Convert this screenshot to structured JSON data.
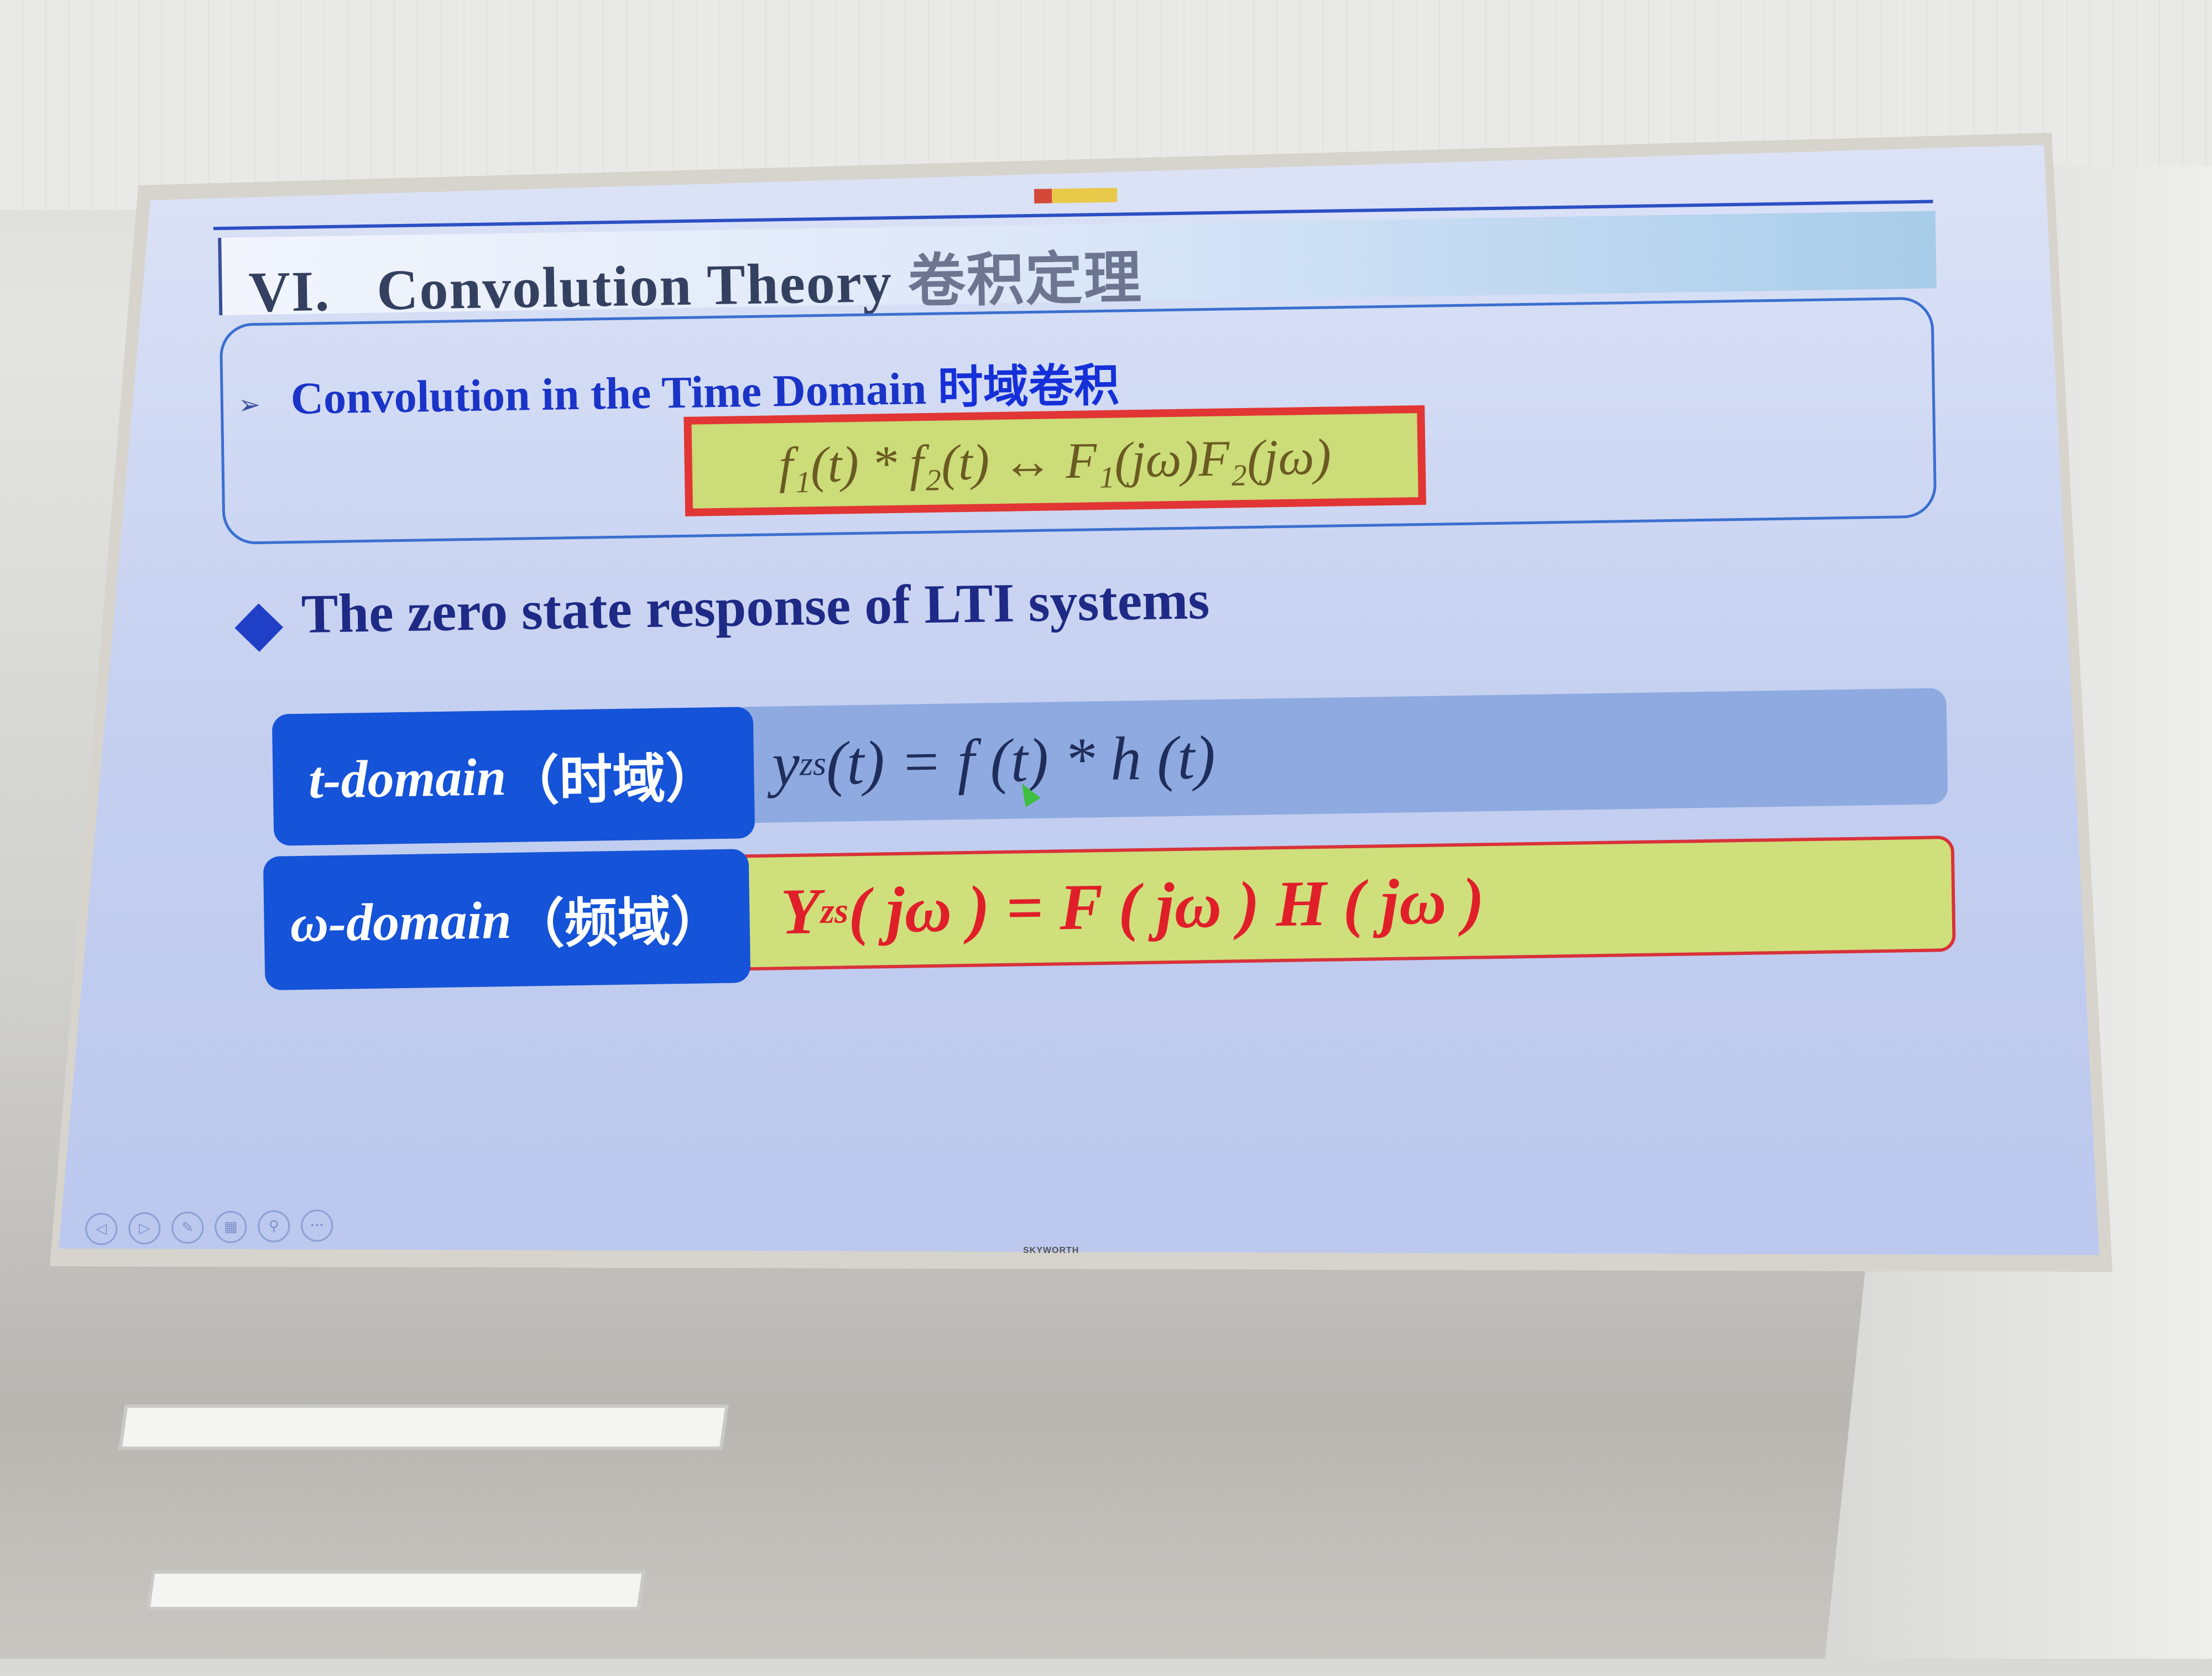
{
  "slide": {
    "title_prefix": "VI.",
    "title_en": "Convolution Theory",
    "title_cn": "卷积定理",
    "subheading_marker": "➢",
    "subheading_en": "Convolution in the Time Domain",
    "subheading_cn": "时域卷积",
    "formula": "f₁(t) * f₂(t)   ↔   F₁(jω)F₂(jω)",
    "bullet": "The zero state response of LTI systems",
    "rows": [
      {
        "label_en": "t-domain",
        "label_cn": "（时域）",
        "eq_main": "y",
        "eq_sub": "zs",
        "eq_rest": "(t) = f (t) * h (t)"
      },
      {
        "label_en": "ω-domain",
        "label_cn": "（频域）",
        "eq_main": "Y",
        "eq_sub": "zs",
        "eq_rest": "( jω ) = F ( jω ) H ( jω )"
      }
    ]
  },
  "toolbar": {
    "icons": [
      "previous-icon",
      "next-icon",
      "pen-icon",
      "slides-icon",
      "zoom-icon",
      "more-icon"
    ],
    "glyphs": [
      "◁",
      "▷",
      "✎",
      "▦",
      "⚲",
      "•••"
    ]
  },
  "tv": {
    "brand": "SKYWORTH"
  },
  "colors": {
    "accent_blue": "#1553d8",
    "highlight_red": "#e01f2a",
    "formula_bg": "#cfdf7c"
  }
}
